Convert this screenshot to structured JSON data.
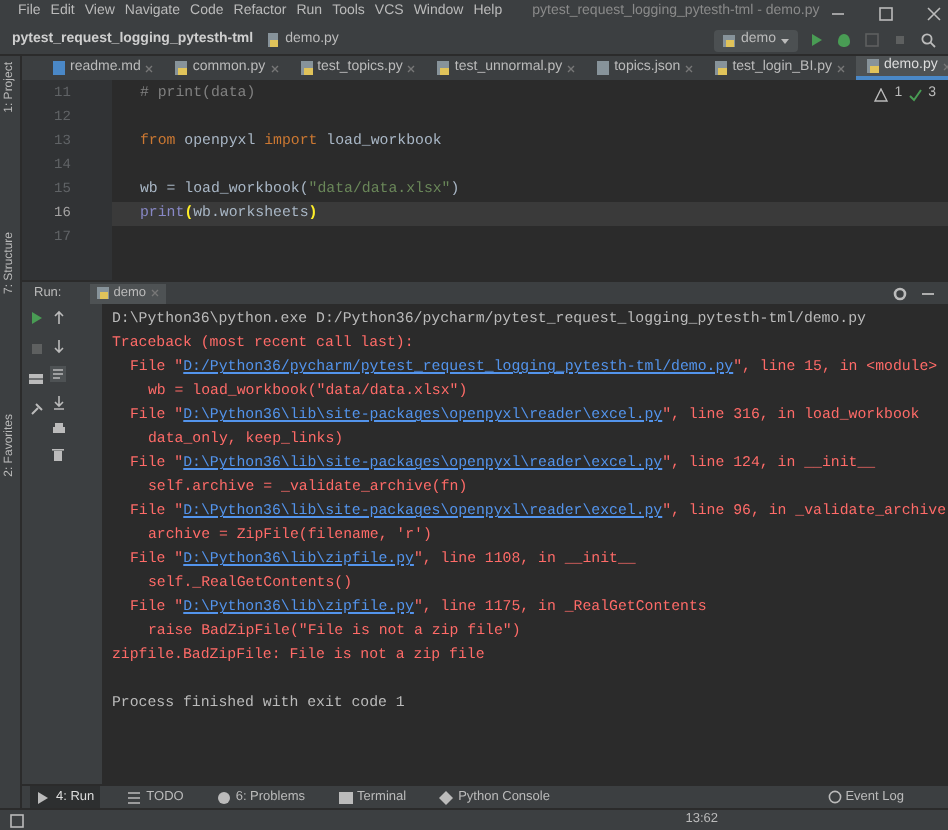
{
  "menu": [
    "File",
    "Edit",
    "View",
    "Navigate",
    "Code",
    "Refactor",
    "Run",
    "Tools",
    "VCS",
    "Window",
    "Help"
  ],
  "window": {
    "title": "pytest_request_logging_pytesth-tml - demo.py"
  },
  "breadcrumb": [
    "pytest_request_logging_pytesth-tml",
    "demo.py"
  ],
  "run_config": "demo",
  "tabs": [
    {
      "label": "readme.md",
      "kind": "md",
      "selected": false
    },
    {
      "label": "common.py",
      "kind": "py",
      "selected": false
    },
    {
      "label": "test_topics.py",
      "kind": "py",
      "selected": false
    },
    {
      "label": "test_unnormal.py",
      "kind": "py",
      "selected": false
    },
    {
      "label": "topics.json",
      "kind": "json",
      "selected": false
    },
    {
      "label": "test_login_BI.py",
      "kind": "py",
      "selected": false
    },
    {
      "label": "demo.py",
      "kind": "py",
      "selected": true
    }
  ],
  "side_tools": [
    "1: Project",
    "7: Structure",
    "2: Favorites"
  ],
  "inspections": {
    "warnings": "1",
    "passed": "3"
  },
  "editor": {
    "lines": [
      {
        "number": "11",
        "current": false,
        "tokens": [
          {
            "text": "# print(data)",
            "kind": "comment"
          }
        ]
      },
      {
        "number": "12",
        "current": false
      },
      {
        "number": "13",
        "current": false,
        "tokens": [
          {
            "text": "from",
            "kind": "keyword"
          },
          {
            "text": " openpyxl ",
            "kind": "plain"
          },
          {
            "text": "import",
            "kind": "keyword"
          },
          {
            "text": " load_workbook",
            "kind": "plain"
          }
        ]
      },
      {
        "number": "14",
        "current": false
      },
      {
        "number": "15",
        "current": false,
        "tokens": [
          {
            "text": "wb = load_workbook(",
            "kind": "plain"
          },
          {
            "text": "\"data/data.xlsx\"",
            "kind": "string"
          },
          {
            "text": ")",
            "kind": "plain"
          }
        ]
      },
      {
        "number": "16",
        "current": true,
        "tokens": [
          {
            "text": "print",
            "kind": "builtin"
          },
          {
            "text": "(",
            "kind": "brace"
          },
          {
            "text": "wb.worksheets",
            "kind": "plain"
          },
          {
            "text": ")",
            "kind": "brace"
          }
        ]
      },
      {
        "number": "17",
        "current": false
      }
    ]
  },
  "run_panel": {
    "label": "Run:",
    "tab": "demo"
  },
  "console": [
    {
      "kind": "command",
      "text": "D:\\Python36\\python.exe D:/Python36/pycharm/pytest_request_logging_pytesth-tml/demo.py"
    },
    {
      "kind": "error",
      "text": "Traceback (most recent call last):"
    },
    {
      "kind": "frame",
      "before": "File \"",
      "link": "D:/Python36/pycharm/pytest_request_logging_pytesth-tml/demo.py",
      "after": "\", line 15, in <module>"
    },
    {
      "kind": "source",
      "text": "wb = load_workbook(\"data/data.xlsx\")"
    },
    {
      "kind": "frame",
      "before": "File \"",
      "link": "D:\\Python36\\lib\\site-packages\\openpyxl\\reader\\excel.py",
      "after": "\", line 316, in load_workbook"
    },
    {
      "kind": "source",
      "text": "data_only, keep_links)"
    },
    {
      "kind": "frame",
      "before": "File \"",
      "link": "D:\\Python36\\lib\\site-packages\\openpyxl\\reader\\excel.py",
      "after": "\", line 124, in __init__"
    },
    {
      "kind": "source",
      "text": "self.archive = _validate_archive(fn)"
    },
    {
      "kind": "frame",
      "before": "File \"",
      "link": "D:\\Python36\\lib\\site-packages\\openpyxl\\reader\\excel.py",
      "after": "\", line 96, in _validate_archive"
    },
    {
      "kind": "source",
      "text": "archive = ZipFile(filename, 'r')"
    },
    {
      "kind": "frame",
      "before": "File \"",
      "link": "D:\\Python36\\lib\\zipfile.py",
      "after": "\", line 1108, in __init__"
    },
    {
      "kind": "source",
      "text": "self._RealGetContents()"
    },
    {
      "kind": "frame",
      "before": "File \"",
      "link": "D:\\Python36\\lib\\zipfile.py",
      "after": "\", line 1175, in _RealGetContents"
    },
    {
      "kind": "source",
      "text": "raise BadZipFile(\"File is not a zip file\")"
    },
    {
      "kind": "error",
      "text": "zipfile.BadZipFile: File is not a zip file"
    },
    {
      "kind": "blank"
    },
    {
      "kind": "plain",
      "text": "Process finished with exit code 1"
    }
  ],
  "bottom_tools": [
    {
      "label": "4: Run",
      "selected": true
    },
    {
      "label": "TODO",
      "selected": false
    },
    {
      "label": "6: Problems",
      "selected": false
    },
    {
      "label": "Terminal",
      "selected": false
    },
    {
      "label": "Python Console",
      "selected": false
    }
  ],
  "event_log": "Event Log",
  "status_bar": {
    "position": "13:62"
  }
}
